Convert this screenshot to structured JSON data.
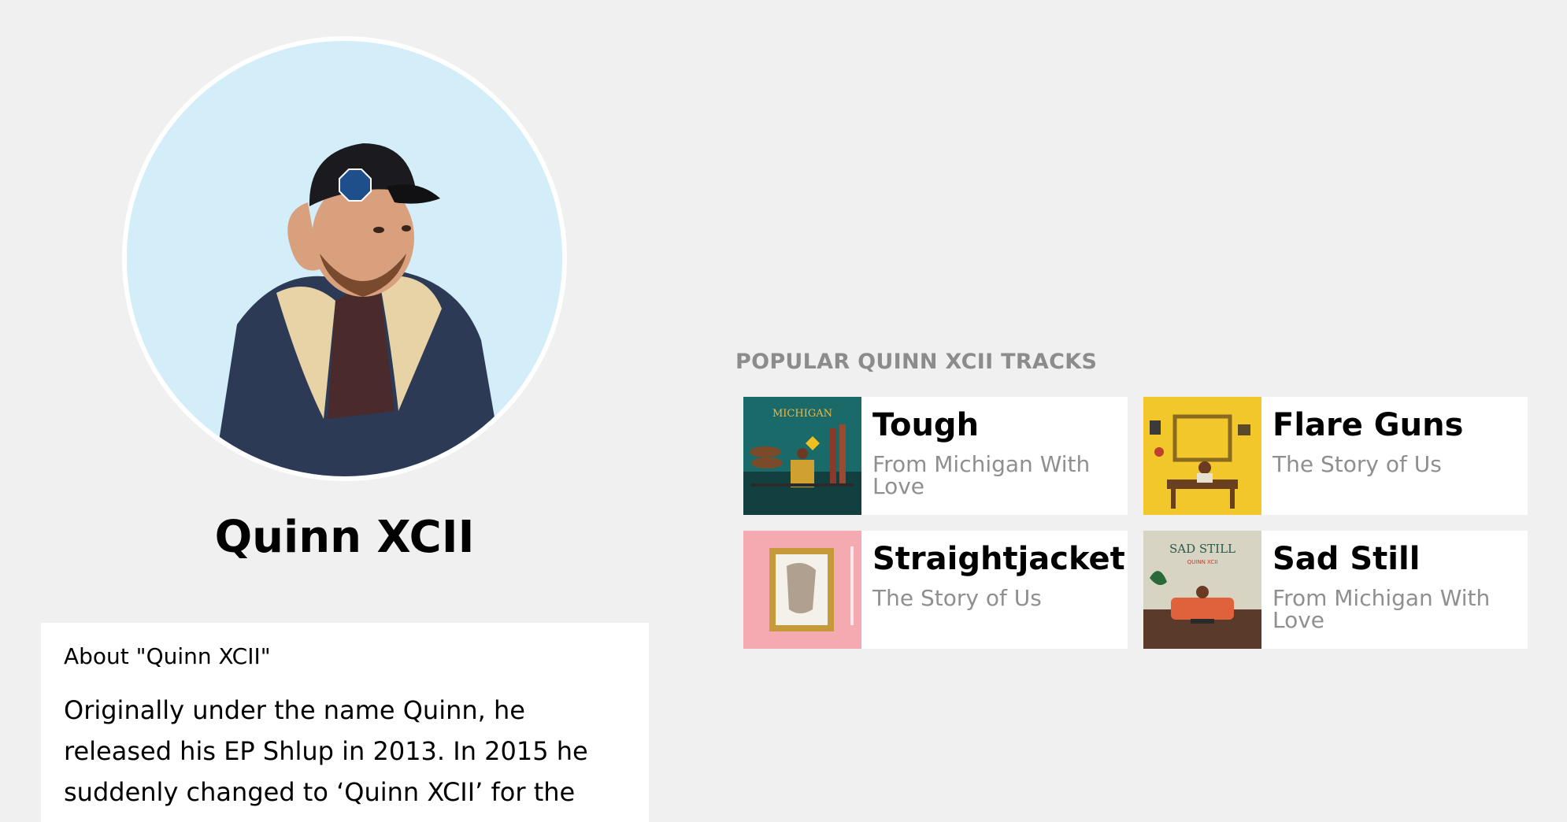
{
  "artist": {
    "name": "Quinn XCII"
  },
  "about": {
    "title": "About \"Quinn XCII\"",
    "body": "Originally under the name Quinn, he released his EP Shlup in 2013. In 2015 he suddenly changed to ‘Quinn XCII’ for the then-new EP"
  },
  "tracks_section": {
    "title": "POPULAR QUINN XCII TRACKS",
    "tracks": [
      {
        "title": "Tough",
        "album": "From Michigan With Love"
      },
      {
        "title": "Flare Guns",
        "album": "The Story of Us"
      },
      {
        "title": "Straightjacket",
        "album": "The Story of Us"
      },
      {
        "title": "Sad Still",
        "album": "From Michigan With Love"
      }
    ]
  },
  "artwork": {
    "michigan_cover_text": "MICHIGAN",
    "sad_still_cover_text": "SAD STILL",
    "sad_still_cover_subtext": "QUINN XCII"
  },
  "colors": {
    "page_background": "#f0f0f0",
    "card_background": "#ffffff",
    "muted_text": "#8c8c8c",
    "avatar_background": "#d3eef9"
  }
}
